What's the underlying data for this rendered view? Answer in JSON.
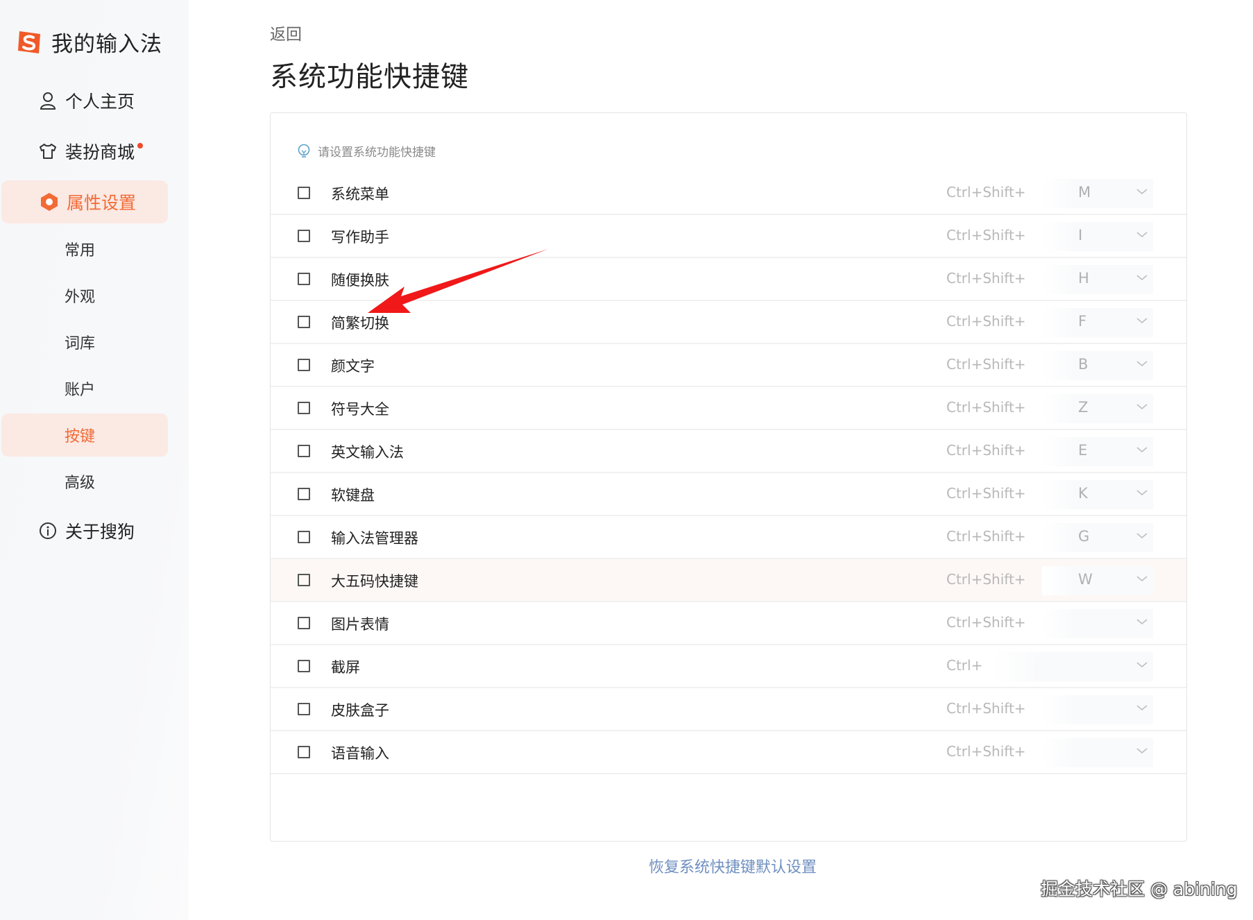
{
  "sidebar": {
    "brand_title": "我的输入法",
    "nav": {
      "profile": "个人主页",
      "store": "装扮商城",
      "settings": "属性设置",
      "about": "关于搜狗"
    },
    "sub_items": [
      "常用",
      "外观",
      "词库",
      "账户",
      "按键",
      "高级"
    ],
    "active_sub": "按键"
  },
  "main": {
    "back_label": "返回",
    "page_title": "系统功能快捷键",
    "hint": "请设置系统功能快捷键",
    "rows": [
      {
        "label": "系统菜单",
        "prefix": "Ctrl+Shift+",
        "key": "M",
        "checked": false
      },
      {
        "label": "写作助手",
        "prefix": "Ctrl+Shift+",
        "key": "I",
        "checked": false
      },
      {
        "label": "随便换肤",
        "prefix": "Ctrl+Shift+",
        "key": "H",
        "checked": false
      },
      {
        "label": "简繁切换",
        "prefix": "Ctrl+Shift+",
        "key": "F",
        "checked": false
      },
      {
        "label": "颜文字",
        "prefix": "Ctrl+Shift+",
        "key": "B",
        "checked": false
      },
      {
        "label": "符号大全",
        "prefix": "Ctrl+Shift+",
        "key": "Z",
        "checked": false
      },
      {
        "label": "英文输入法",
        "prefix": "Ctrl+Shift+",
        "key": "E",
        "checked": false
      },
      {
        "label": "软键盘",
        "prefix": "Ctrl+Shift+",
        "key": "K",
        "checked": false
      },
      {
        "label": "输入法管理器",
        "prefix": "Ctrl+Shift+",
        "key": "G",
        "checked": false
      },
      {
        "label": "大五码快捷键",
        "prefix": "Ctrl+Shift+",
        "key": "W",
        "checked": false
      },
      {
        "label": "图片表情",
        "prefix": "Ctrl+Shift+",
        "key": "",
        "checked": false
      },
      {
        "label": "截屏",
        "prefix": "Ctrl+",
        "key": "",
        "checked": false
      },
      {
        "label": "皮肤盒子",
        "prefix": "Ctrl+Shift+",
        "key": "",
        "checked": false
      },
      {
        "label": "语音输入",
        "prefix": "Ctrl+Shift+",
        "key": "",
        "checked": false
      }
    ],
    "restore_label": "恢复系统快捷键默认设置"
  },
  "watermark": "掘金技术社区 @ abining",
  "colors": {
    "accent": "#f26a35",
    "active_bg": "#fbe9e3",
    "link": "#6f8fc0",
    "annotation_arrow": "#f01818"
  }
}
